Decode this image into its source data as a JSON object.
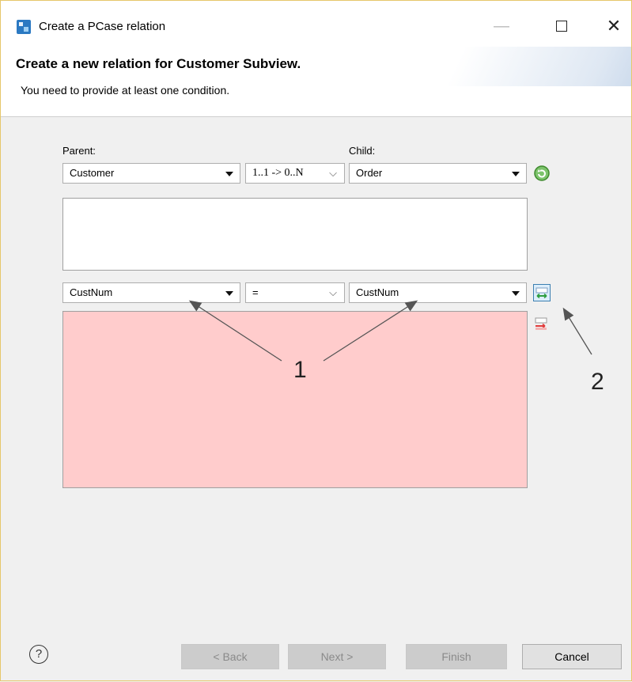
{
  "window": {
    "title": "Create a PCase relation",
    "minimize_glyph": "—",
    "close_glyph": "✕"
  },
  "header": {
    "title": "Create a new relation for Customer Subview.",
    "message": "You need to provide at least one condition."
  },
  "form": {
    "parent_label": "Parent:",
    "child_label": "Child:",
    "parent_value": "Customer",
    "cardinality_value": "1..1 -> 0..N",
    "child_value": "Order",
    "refresh_icon": "refresh-icon",
    "condition": {
      "parent_field": "CustNum",
      "operator": "=",
      "child_field": "CustNum",
      "add_icon": "add-condition-icon",
      "remove_icon": "remove-condition-icon"
    }
  },
  "annotations": {
    "callout_1": "1",
    "callout_2": "2"
  },
  "buttons": {
    "help": "?",
    "back": "< Back",
    "next": "Next >",
    "finish": "Finish",
    "cancel": "Cancel"
  },
  "colors": {
    "conditions_list_bg": "#ffcccc",
    "accent": "#2b79c2"
  }
}
